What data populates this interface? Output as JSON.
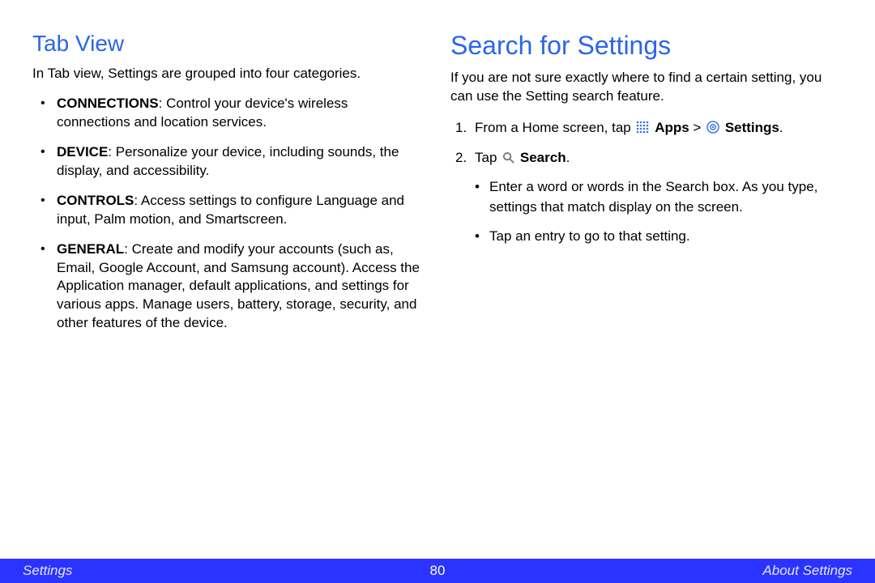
{
  "left": {
    "heading": "Tab View",
    "intro": "In Tab view, Settings are grouped into four categories.",
    "items": [
      {
        "label": "CONNECTIONS",
        "desc": ": Control your device's wireless connections and location services."
      },
      {
        "label": "DEVICE",
        "desc": ": Personalize your device, including sounds, the display, and accessibility."
      },
      {
        "label": "CONTROLS",
        "desc": ": Access settings to configure Language and input, Palm motion, and Smartscreen."
      },
      {
        "label": "GENERAL",
        "desc": ": Create and modify your accounts (such as, Email, Google Account, and Samsung account). Access the Application manager, default applications, and settings for various apps. Manage users, battery, storage, security, and other features of the device."
      }
    ]
  },
  "right": {
    "heading": "Search for Settings",
    "intro": "If you are not sure exactly where to find a certain setting, you can use the Setting search feature.",
    "step1_pre": "From a Home screen, tap ",
    "step1_apps": "Apps",
    "step1_gt": " > ",
    "step1_settings": "Settings",
    "step1_end": ".",
    "step2_pre": "Tap ",
    "step2_search": "Search",
    "step2_end": ".",
    "sub1": "Enter a word or words in the Search box. As you type, settings that match display on the screen.",
    "sub2": "Tap an entry to go to that setting."
  },
  "footer": {
    "left": "Settings",
    "page": "80",
    "right": "About Settings"
  }
}
